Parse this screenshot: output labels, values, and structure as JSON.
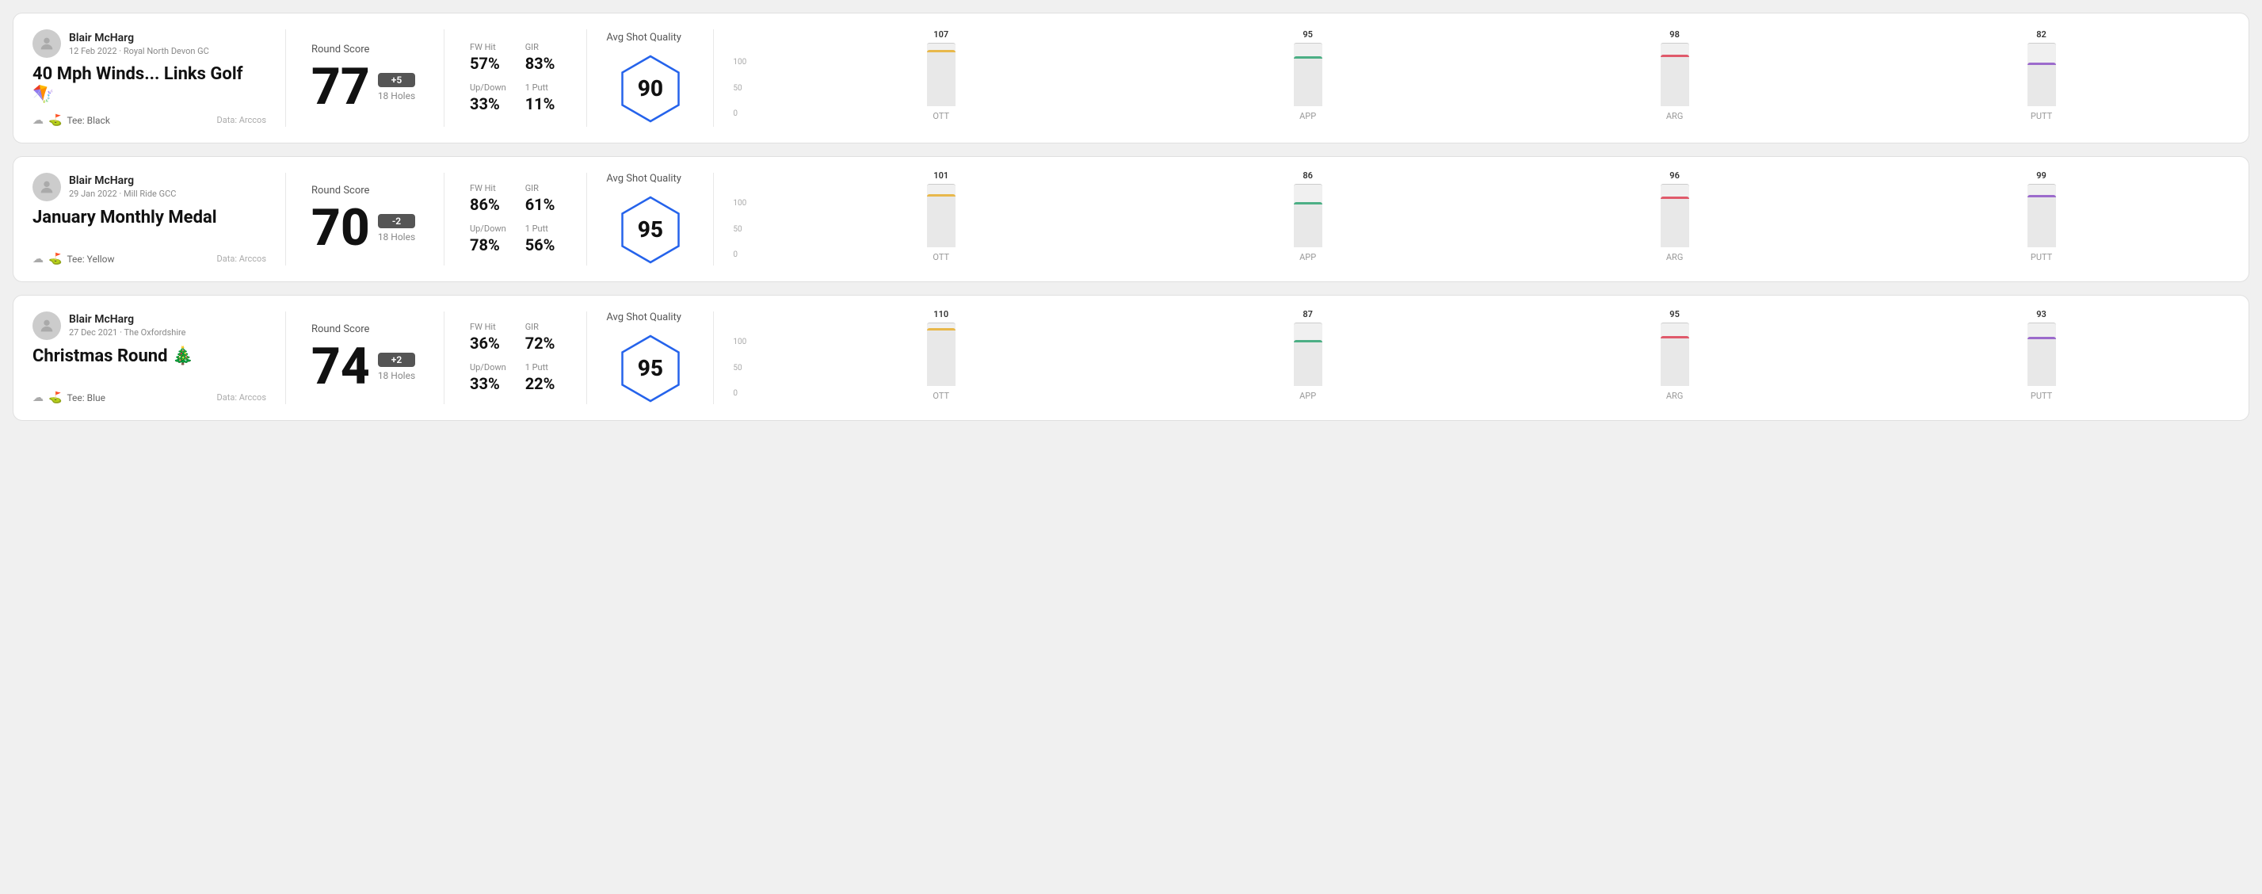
{
  "rounds": [
    {
      "id": "round1",
      "user": {
        "name": "Blair McHarg",
        "date_course": "12 Feb 2022 · Royal North Devon GC"
      },
      "title": "40 Mph Winds... Links Golf 🪁",
      "tee": "Black",
      "data_source": "Data: Arccos",
      "round_score_label": "Round Score",
      "score": "77",
      "score_badge": "+5",
      "holes": "18 Holes",
      "fw_hit_label": "FW Hit",
      "fw_hit_value": "57%",
      "gir_label": "GIR",
      "gir_value": "83%",
      "updown_label": "Up/Down",
      "updown_value": "33%",
      "oneputt_label": "1 Putt",
      "oneputt_value": "11%",
      "quality_label": "Avg Shot Quality",
      "quality_score": "90",
      "bars": [
        {
          "label": "OTT",
          "value": 107,
          "color": "#e8b84b"
        },
        {
          "label": "APP",
          "value": 95,
          "color": "#4caf85"
        },
        {
          "label": "ARG",
          "value": 98,
          "color": "#e05a6b"
        },
        {
          "label": "PUTT",
          "value": 82,
          "color": "#9c6bcc"
        }
      ]
    },
    {
      "id": "round2",
      "user": {
        "name": "Blair McHarg",
        "date_course": "29 Jan 2022 · Mill Ride GCC"
      },
      "title": "January Monthly Medal",
      "tee": "Yellow",
      "data_source": "Data: Arccos",
      "round_score_label": "Round Score",
      "score": "70",
      "score_badge": "-2",
      "holes": "18 Holes",
      "fw_hit_label": "FW Hit",
      "fw_hit_value": "86%",
      "gir_label": "GIR",
      "gir_value": "61%",
      "updown_label": "Up/Down",
      "updown_value": "78%",
      "oneputt_label": "1 Putt",
      "oneputt_value": "56%",
      "quality_label": "Avg Shot Quality",
      "quality_score": "95",
      "bars": [
        {
          "label": "OTT",
          "value": 101,
          "color": "#e8b84b"
        },
        {
          "label": "APP",
          "value": 86,
          "color": "#4caf85"
        },
        {
          "label": "ARG",
          "value": 96,
          "color": "#e05a6b"
        },
        {
          "label": "PUTT",
          "value": 99,
          "color": "#9c6bcc"
        }
      ]
    },
    {
      "id": "round3",
      "user": {
        "name": "Blair McHarg",
        "date_course": "27 Dec 2021 · The Oxfordshire"
      },
      "title": "Christmas Round 🎄",
      "tee": "Blue",
      "data_source": "Data: Arccos",
      "round_score_label": "Round Score",
      "score": "74",
      "score_badge": "+2",
      "holes": "18 Holes",
      "fw_hit_label": "FW Hit",
      "fw_hit_value": "36%",
      "gir_label": "GIR",
      "gir_value": "72%",
      "updown_label": "Up/Down",
      "updown_value": "33%",
      "oneputt_label": "1 Putt",
      "oneputt_value": "22%",
      "quality_label": "Avg Shot Quality",
      "quality_score": "95",
      "bars": [
        {
          "label": "OTT",
          "value": 110,
          "color": "#e8b84b"
        },
        {
          "label": "APP",
          "value": 87,
          "color": "#4caf85"
        },
        {
          "label": "ARG",
          "value": 95,
          "color": "#e05a6b"
        },
        {
          "label": "PUTT",
          "value": 93,
          "color": "#9c6bcc"
        }
      ]
    }
  ],
  "chart": {
    "y_labels": [
      "100",
      "50",
      "0"
    ]
  }
}
